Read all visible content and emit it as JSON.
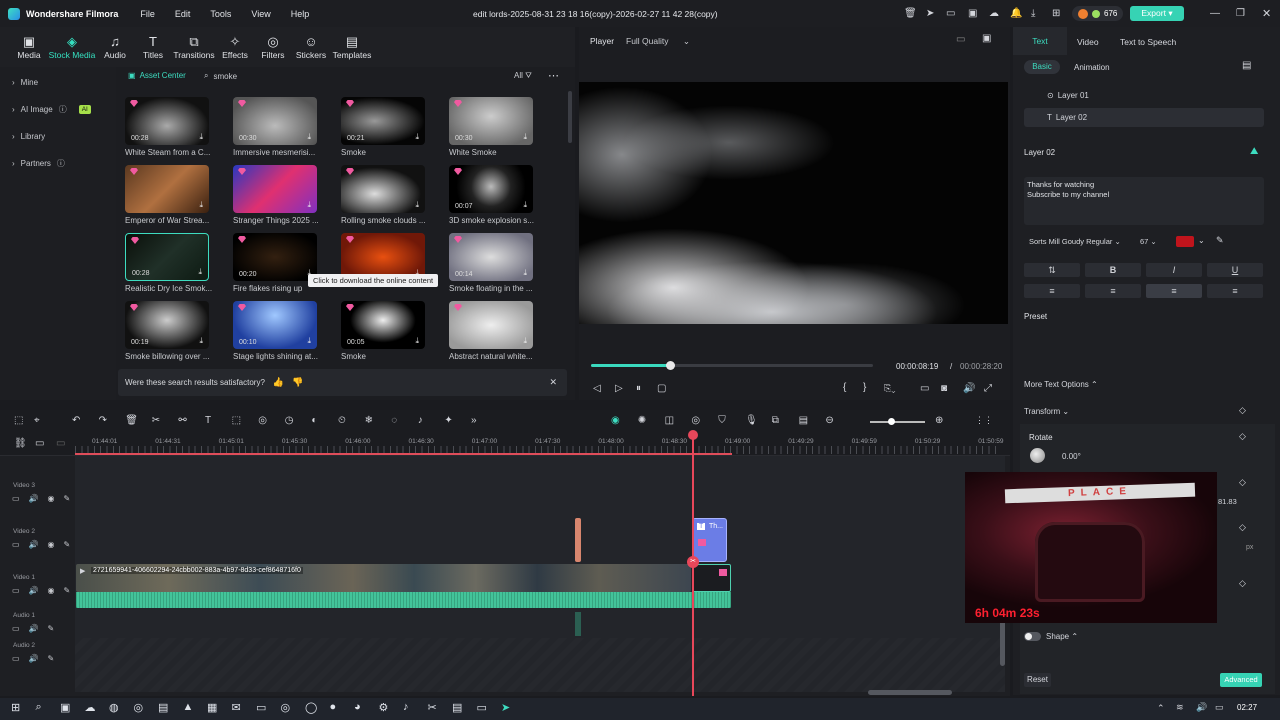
{
  "app": {
    "name": "Wondershare Filmora",
    "project_title": "edit lords-2025-08-31 23 18 16(copy)-2026-02-27 11 42 28(copy)",
    "credits": "676",
    "export_label": "Export",
    "menu": [
      "File",
      "Edit",
      "Tools",
      "View",
      "Help"
    ]
  },
  "toolbar": [
    {
      "label": "Media",
      "icon": "media-icon",
      "glyph": "▣"
    },
    {
      "label": "Stock Media",
      "icon": "stock-media-icon",
      "glyph": "◈"
    },
    {
      "label": "Audio",
      "icon": "audio-icon",
      "glyph": "♫"
    },
    {
      "label": "Titles",
      "icon": "titles-icon",
      "glyph": "T"
    },
    {
      "label": "Transitions",
      "icon": "transitions-icon",
      "glyph": "⧉"
    },
    {
      "label": "Effects",
      "icon": "effects-icon",
      "glyph": "✧"
    },
    {
      "label": "Filters",
      "icon": "filters-icon",
      "glyph": "◎"
    },
    {
      "label": "Stickers",
      "icon": "stickers-icon",
      "glyph": "☺"
    },
    {
      "label": "Templates",
      "icon": "templates-icon",
      "glyph": "▤"
    }
  ],
  "sidebar": {
    "items": [
      "Mine",
      "AI Image",
      "Library",
      "Partners"
    ],
    "ai_badge": "AI"
  },
  "media": {
    "asset_center": "Asset Center",
    "search_value": "smoke",
    "filter_label": "All",
    "tooltip": "Click to download the online content",
    "feedback": "Were these search results satisfactory?",
    "items": [
      {
        "caption": "White Steam from a C...",
        "duration": "00:28"
      },
      {
        "caption": "Immersive mesmerisi...",
        "duration": "00:30"
      },
      {
        "caption": "Smoke",
        "duration": "00:21"
      },
      {
        "caption": "White Smoke",
        "duration": "00:30"
      },
      {
        "caption": "Emperor of War Strea...",
        "duration": ""
      },
      {
        "caption": "Stranger Things 2025 ...",
        "duration": ""
      },
      {
        "caption": "Rolling smoke clouds ...",
        "duration": ""
      },
      {
        "caption": "3D smoke explosion s...",
        "duration": "00:07"
      },
      {
        "caption": "Realistic Dry Ice Smok...",
        "duration": "00:28"
      },
      {
        "caption": "Fire flakes rising up",
        "duration": "00:20"
      },
      {
        "caption": "",
        "duration": ""
      },
      {
        "caption": "Smoke floating in the ...",
        "duration": "00:14"
      },
      {
        "caption": "Smoke billowing over ...",
        "duration": "00:19"
      },
      {
        "caption": "Stage lights shining at...",
        "duration": "00:10"
      },
      {
        "caption": "Smoke",
        "duration": "00:05"
      },
      {
        "caption": "Abstract natural white...",
        "duration": ""
      }
    ]
  },
  "player": {
    "tab": "Player",
    "quality": "Full Quality",
    "current_time": "00:00:08:19",
    "total_time": "00:00:28:20",
    "progress": 0.28
  },
  "right": {
    "tabs": [
      "Text",
      "Video",
      "Text to Speech"
    ],
    "subtabs": [
      "Basic",
      "Animation"
    ],
    "layers": [
      "Layer 01",
      "Layer 02"
    ],
    "section_title": "Layer 02",
    "text_content_1": "Thanks for watching",
    "text_content_2": "Subscribe to my channel",
    "font": "Sorts Mill Goudy Regular",
    "font_size": "67",
    "text_color": "#c0141c",
    "bold": "B",
    "italic": "I",
    "underline": "U",
    "preset": "Preset",
    "more_text_options": "More Text Options",
    "transform": "Transform",
    "rotate": "Rotate",
    "rotate_value": "0.00°",
    "scale_value": "81.83",
    "unit_px": "px",
    "shape": "Shape",
    "reset": "Reset",
    "advanced": "Advanced"
  },
  "timeline": {
    "ruler": [
      "01:44:01",
      "01:44:31",
      "01:45:01",
      "01:45:30",
      "01:46:00",
      "01:46:30",
      "01:47:00",
      "01:47:30",
      "01:48:00",
      "01:48:30",
      "01:49:00",
      "01:49:29",
      "01:49:59",
      "01:50:29",
      "01:50:59"
    ],
    "tracks": [
      "Video 3",
      "Video 2",
      "Video 1",
      "Audio 1",
      "Audio 2"
    ],
    "clip_name": "2721659941-406602294-24cbb002-883a-4b97-8d33-cef8648716f0",
    "title_clip": "Th..."
  },
  "overlay": {
    "caption": "6h 04m 23s",
    "sign_text": "PLACE"
  },
  "taskbar": {
    "time": "02:27"
  }
}
